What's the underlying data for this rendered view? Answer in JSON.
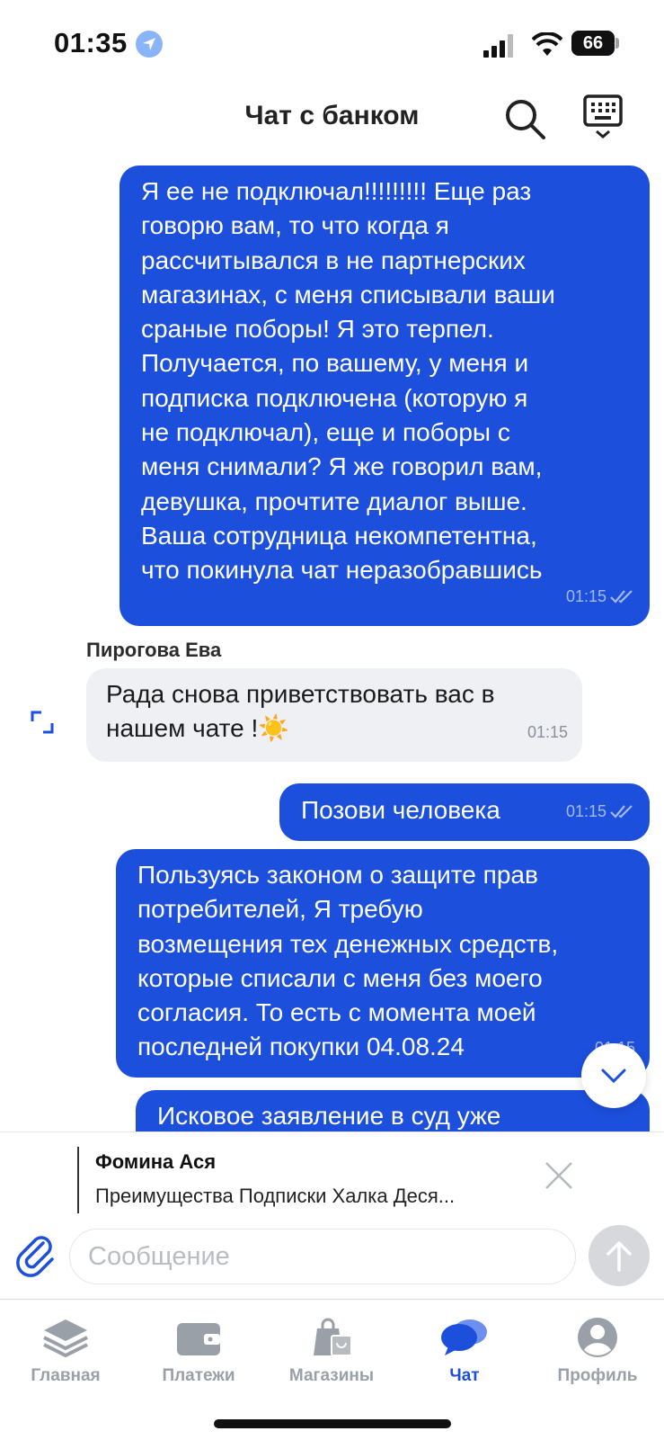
{
  "status_bar": {
    "time": "01:35",
    "battery": "66"
  },
  "header": {
    "title": "Чат с банком"
  },
  "messages": [
    {
      "direction": "outgoing",
      "text": "Я ее не подключал!!!!!!!!! Еще раз\nговорю  вам, то что когда я\nрассчитывался в не партнерских\nмагазинах, с меня списывали ваши\nсраные поборы! Я это терпел.\nПолучается, по вашему, у меня и\nподписка подключена (которую я\nне подключал), еще и поборы с\nменя снимали? Я же говорил вам,\nдевушка, прочтите диалог выше.\nВаша сотрудница некомпетентна,\nчто покинула чат неразобравшись",
      "time": "01:15"
    },
    {
      "direction": "incoming",
      "sender": "Пирогова Ева",
      "text": "Рада снова приветствовать вас в\nнашем чате !☀️",
      "time": "01:15"
    },
    {
      "direction": "outgoing",
      "text": "Позови человека",
      "time": "01:15"
    },
    {
      "direction": "outgoing",
      "text": "Пользуясь законом о защите прав\nпотребителей, Я требую\nвозмещения тех денежных средств,\nкоторые списали с меня без моего\nсогласия. То есть с момента моей\nпоследней покупки 04.08.24",
      "time": "01:15"
    },
    {
      "direction": "outgoing",
      "text": "Исковое заявление в суд уже",
      "time": ""
    }
  ],
  "reply_preview": {
    "author": "Фомина Ася",
    "text": "Преимущества Подписки Халка Деся..."
  },
  "composer": {
    "placeholder": "Сообщение"
  },
  "tabs": [
    {
      "label": "Главная",
      "icon": "stack-icon",
      "active": false
    },
    {
      "label": "Платежи",
      "icon": "wallet-icon",
      "active": false
    },
    {
      "label": "Магазины",
      "icon": "shopping-bags-icon",
      "active": false
    },
    {
      "label": "Чат",
      "icon": "chat-bubbles-icon",
      "active": true
    },
    {
      "label": "Профиль",
      "icon": "profile-icon",
      "active": false
    }
  ],
  "colors": {
    "accent": "#1c4fdc",
    "incoming_bubble": "#eef0f4",
    "inactive_tab": "#9aa0a8"
  }
}
